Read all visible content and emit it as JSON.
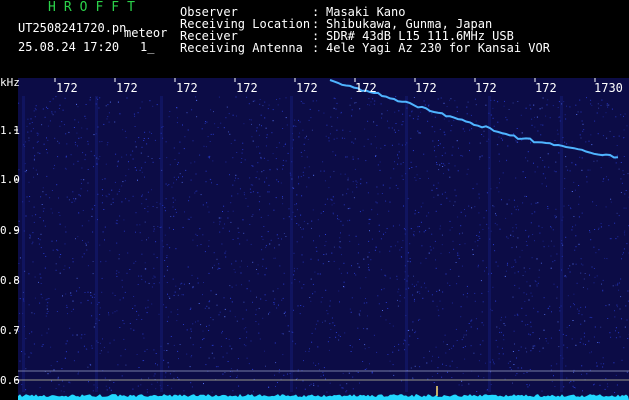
{
  "header": {
    "brand": "HROFFT",
    "filename": "UT2508241720.pn",
    "tag": "meteor",
    "datetime": "25.08.24 17:20",
    "counter": "1_",
    "fields": [
      {
        "label": "Observer",
        "value": "Masaki Kano"
      },
      {
        "label": "Receiving Location",
        "value": "Shibukawa, Gunma, Japan"
      },
      {
        "label": "Receiver",
        "value": "SDR# 43dB L15 111.6MHz USB"
      },
      {
        "label": "Receiving Antenna",
        "value": "4ele Yagi Az 230 for Kansai VOR"
      }
    ]
  },
  "axes": {
    "y_unit": "kHz",
    "y_ticks": [
      "1.1",
      "1.0",
      "0.9",
      "0.8",
      "0.7",
      "0.6"
    ],
    "x_ticks": [
      "172",
      "172",
      "172",
      "172",
      "172",
      "172",
      "172",
      "172",
      "172",
      "1730"
    ]
  },
  "colors": {
    "background": "#0c0c46",
    "noise": "#2a3fd8",
    "trail": "#4fb4ff",
    "baseline": "#22d8ff",
    "text": "#ffffff",
    "brand": "#2bd24a"
  }
}
